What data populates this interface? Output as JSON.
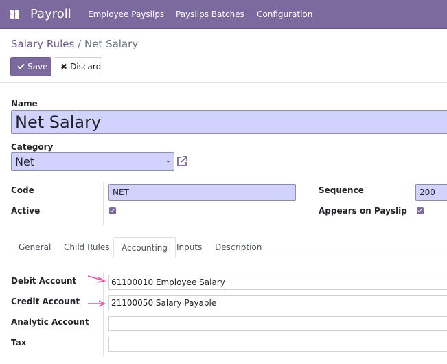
{
  "app": {
    "brand": "Payroll",
    "menu": [
      "Employee Payslips",
      "Payslips Batches",
      "Configuration"
    ]
  },
  "breadcrumb": {
    "parent": "Salary Rules",
    "separator": "/",
    "current": "Net Salary"
  },
  "actions": {
    "save_label": "Save",
    "discard_label": "Discard"
  },
  "form": {
    "name_label": "Name",
    "name_value": "Net Salary",
    "category_label": "Category",
    "category_value": "Net",
    "code_label": "Code",
    "code_value": "NET",
    "active_label": "Active",
    "sequence_label": "Sequence",
    "sequence_value": "200",
    "appears_label": "Appears on Payslip"
  },
  "tabs": [
    "General",
    "Child Rules",
    "Accounting",
    "Inputs",
    "Description"
  ],
  "active_tab": "Accounting",
  "accounting": {
    "debit_label": "Debit Account",
    "debit_value": "61100010 Employee Salary",
    "credit_label": "Credit Account",
    "credit_value": "21100050 Salary Payable",
    "analytic_label": "Analytic Account",
    "analytic_value": "",
    "tax_label": "Tax",
    "tax_value": ""
  },
  "icons": {
    "apps": "apps-grid-icon",
    "save": "check-icon",
    "discard": "close-icon",
    "external": "external-link-icon",
    "arrow": "pink-arrow-annotation"
  },
  "colors": {
    "brand": "#7c6a9e",
    "required_field": "#d2d2ff",
    "annotation_arrow": "#f0509e"
  }
}
